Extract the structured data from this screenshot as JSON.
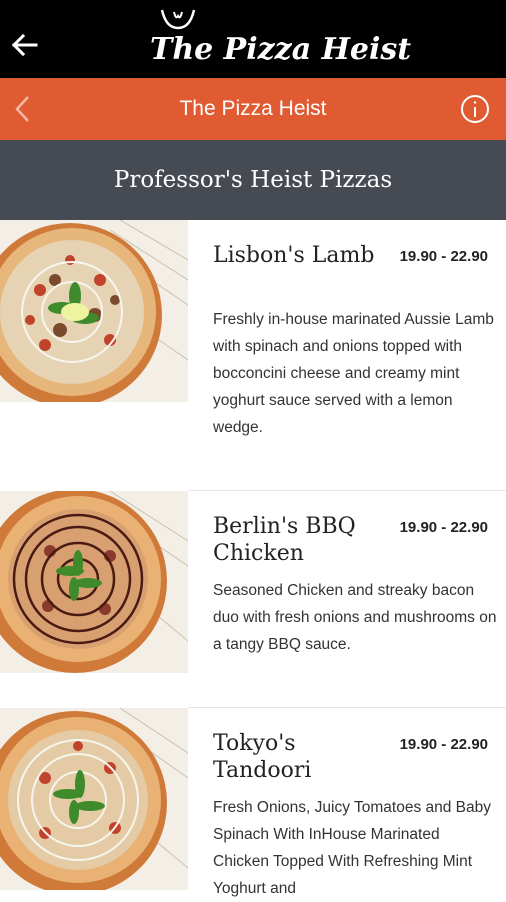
{
  "header": {
    "brand": "The Pizza Heist"
  },
  "nav": {
    "title": "The Pizza Heist"
  },
  "section": {
    "title": "Professor's Heist Pizzas"
  },
  "items": [
    {
      "name": "Lisbon's Lamb",
      "price": "19.90 - 22.90",
      "description": "Freshly in-house marinated Aussie Lamb with spinach and onions topped with bocconcini cheese and creamy mint yoghurt sauce served with a lemon wedge."
    },
    {
      "name": "Berlin's BBQ Chicken",
      "price": "19.90 - 22.90",
      "description": "Seasoned Chicken and streaky bacon duo with fresh onions and mushrooms on a tangy BBQ sauce."
    },
    {
      "name": "Tokyo's Tandoori",
      "price": "19.90 - 22.90",
      "description": "Fresh Onions, Juicy Tomatoes and Baby Spinach With InHouse Marinated Chicken Topped With Refreshing Mint Yoghurt and"
    }
  ],
  "colors": {
    "topbar": "#000000",
    "accent": "#e05a32",
    "section": "#464a53"
  },
  "icons": {
    "back": "arrow-left-icon",
    "nav_back": "chevron-left-icon",
    "info": "info-icon"
  }
}
